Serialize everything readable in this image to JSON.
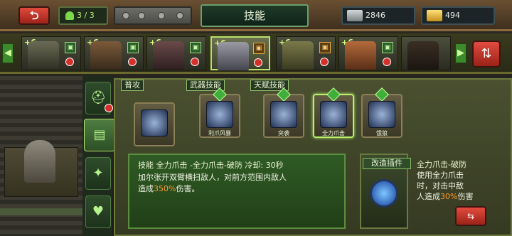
{
  "header": {
    "title": "技能",
    "squad": "3 / 3",
    "back_icon": "back-arrow-icon",
    "resources": [
      {
        "name": "silver",
        "icon": "silver-bar-icon",
        "amount": "2846"
      },
      {
        "name": "gold",
        "icon": "gold-bar-icon",
        "amount": "494"
      }
    ]
  },
  "roster": {
    "heroes": [
      {
        "level": "+6",
        "role": "soldier",
        "selected": false
      },
      {
        "level": "+6",
        "role": "soldier",
        "selected": false
      },
      {
        "level": "+6",
        "role": "soldier",
        "selected": false
      },
      {
        "level": "+6",
        "role": "beast",
        "selected": true
      },
      {
        "level": "+6",
        "role": "beast",
        "selected": false
      },
      {
        "level": "+6",
        "role": "soldier",
        "selected": false
      },
      {
        "level": "",
        "role": "",
        "selected": false
      }
    ]
  },
  "skills": {
    "groups": {
      "basic": "普攻",
      "weapon": "武器技能",
      "talent": "天赋技能"
    },
    "slots": [
      {
        "name": "",
        "icon": "claw-icon"
      },
      {
        "name": "利爪风暴",
        "icon": "claw-storm-icon"
      },
      {
        "name": "突袭",
        "icon": "pounce-icon"
      },
      {
        "name": "全力爪击",
        "icon": "full-claw-icon",
        "active": true
      },
      {
        "name": "饿狼",
        "icon": "wolf-icon"
      }
    ],
    "detail": {
      "head": "技能 全力爪击 -全力爪击-破防 冷却: 30秒",
      "line1": "加尔张开双臂横扫敌人，对前方范围内敌人",
      "line2_prefix": "造成",
      "line2_value": "350%",
      "line2_suffix": "伤害。"
    }
  },
  "mod": {
    "title": "改造插件",
    "name": "全力爪击-破防",
    "desc_1": "使用全力爪击",
    "desc_2": "时，对击中敌",
    "desc_3_prefix": "人造成",
    "desc_3_value": "30%",
    "desc_3_suffix": "伤害"
  },
  "colors": {
    "accent_green": "#b8f06b",
    "highlight": "#ff9a2a",
    "danger": "#d5302a"
  }
}
